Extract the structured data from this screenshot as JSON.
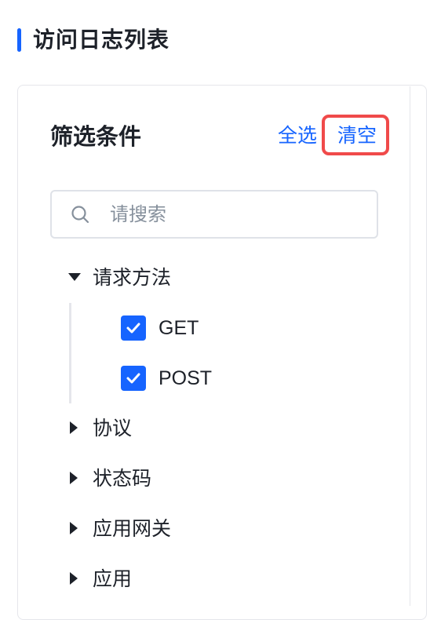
{
  "page": {
    "title": "访问日志列表"
  },
  "filter": {
    "title": "筛选条件",
    "select_all": "全选",
    "clear": "清空",
    "search": {
      "placeholder": "请搜索",
      "value": ""
    },
    "tree": [
      {
        "label": "请求方法",
        "expanded": true,
        "children": [
          {
            "label": "GET",
            "checked": true
          },
          {
            "label": "POST",
            "checked": true
          }
        ]
      },
      {
        "label": "协议",
        "expanded": false
      },
      {
        "label": "状态码",
        "expanded": false
      },
      {
        "label": "应用网关",
        "expanded": false
      },
      {
        "label": "应用",
        "expanded": false
      }
    ]
  },
  "colors": {
    "accent": "#1664ff",
    "highlight": "#f04a4a",
    "text": "#1d2129",
    "placeholder": "#86909c",
    "border": "#e5e6eb"
  }
}
